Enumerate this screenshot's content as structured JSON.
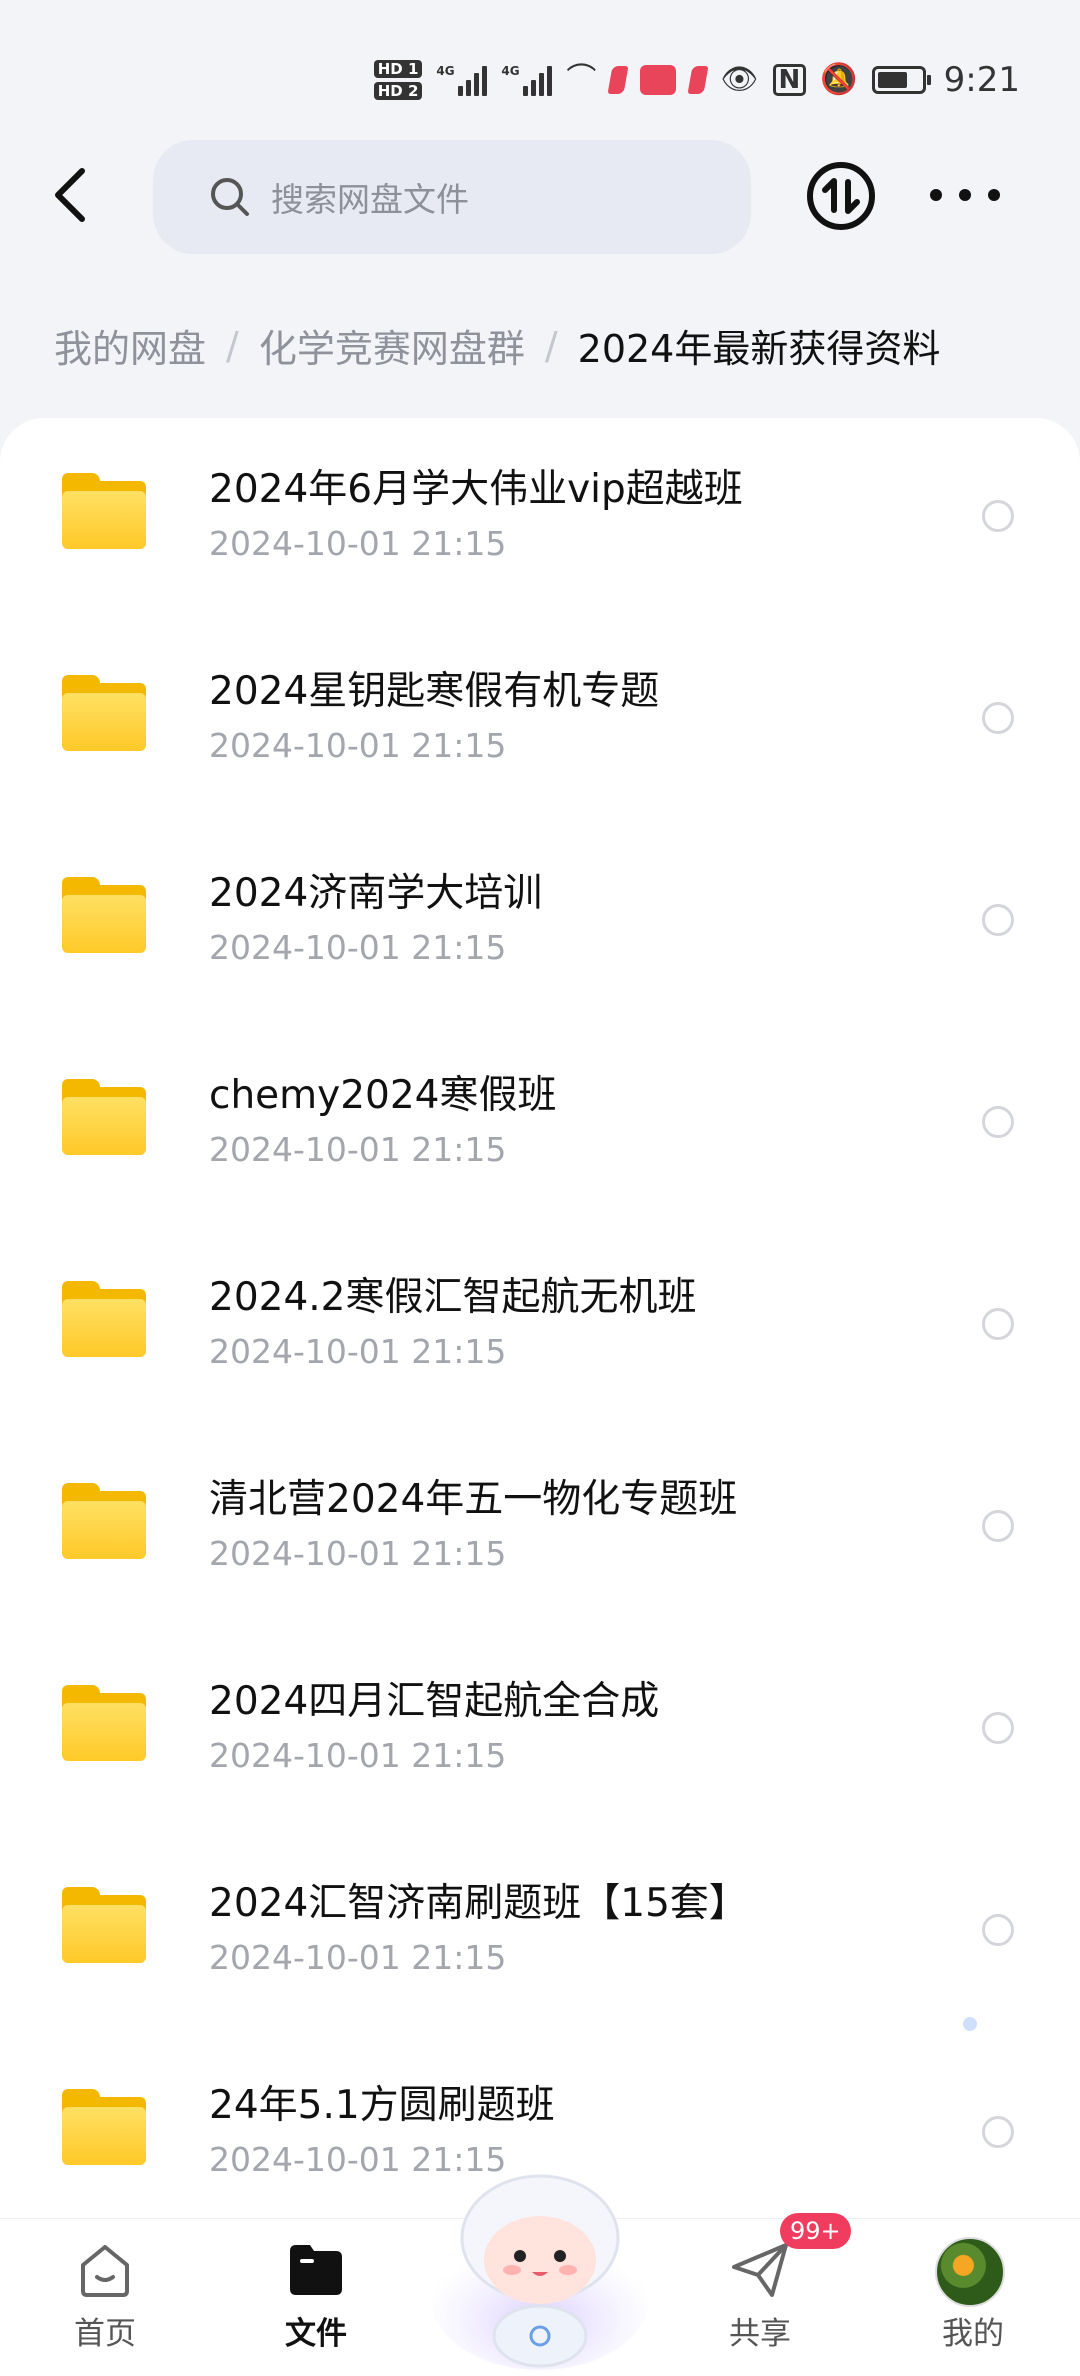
{
  "status_bar": {
    "time": "9:21",
    "hd1": "HD 1",
    "hd2": "HD 2",
    "net1": "4G",
    "net2": "4G",
    "battery_level": 0.7
  },
  "header": {
    "search_placeholder": "搜索网盘文件"
  },
  "breadcrumb": [
    "我的网盘",
    "化学竞赛网盘群",
    "2024年最新获得资料"
  ],
  "files": [
    {
      "name": "2024年6月学大伟业vip超越班",
      "date": "2024-10-01  21:15"
    },
    {
      "name": "2024星钥匙寒假有机专题",
      "date": "2024-10-01  21:15"
    },
    {
      "name": "2024济南学大培训",
      "date": "2024-10-01  21:15"
    },
    {
      "name": "chemy2024寒假班",
      "date": "2024-10-01  21:15"
    },
    {
      "name": "2024.2寒假汇智起航无机班",
      "date": "2024-10-01  21:15"
    },
    {
      "name": "清北营2024年五一物化专题班",
      "date": "2024-10-01  21:15"
    },
    {
      "name": "2024四月汇智起航全合成",
      "date": "2024-10-01  21:15"
    },
    {
      "name": "2024汇智济南刷题班【15套】",
      "date": "2024-10-01  21:15"
    },
    {
      "name": "24年5.1方圆刷题班",
      "date": "2024-10-01  21:15"
    }
  ],
  "bottom_nav": {
    "home": "首页",
    "files": "文件",
    "share": "共享",
    "share_badge": "99+",
    "mine": "我的"
  },
  "colors": {
    "accent": "#111111",
    "folder": "#ffc928",
    "badge": "#f03c5f"
  }
}
